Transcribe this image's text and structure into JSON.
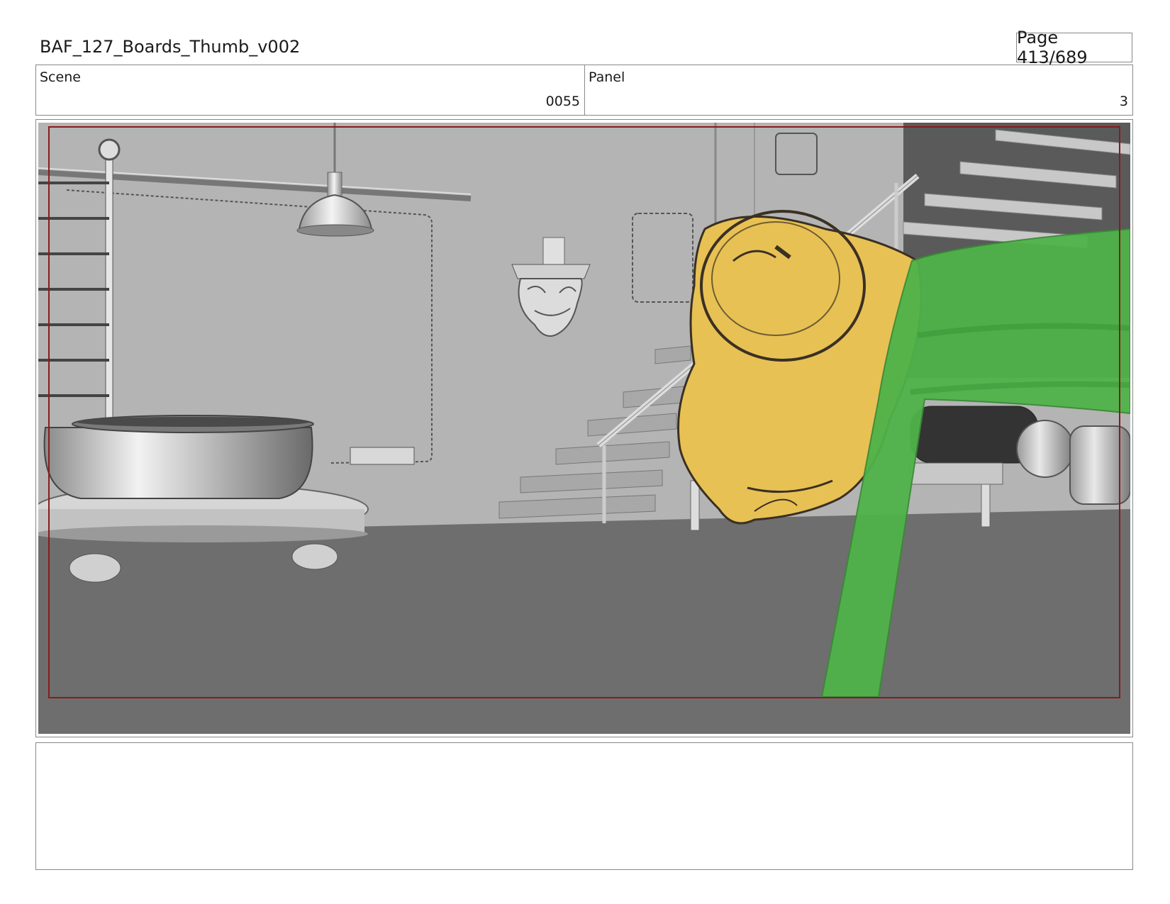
{
  "document": {
    "title": "BAF_127_Boards_Thumb_v002",
    "page": "Page 413/689"
  },
  "header": {
    "scene_label": "Scene",
    "scene_value": "0055",
    "panel_label": "Panel",
    "panel_value": "3"
  },
  "frame": {
    "colors": {
      "wall": "#b4b4b4",
      "floor": "#6e6e6e",
      "safe_area": "#8b1a1a",
      "character_yellow": "#e8c154",
      "character_green": "#4fb34a"
    }
  },
  "notes": {
    "text": ""
  }
}
